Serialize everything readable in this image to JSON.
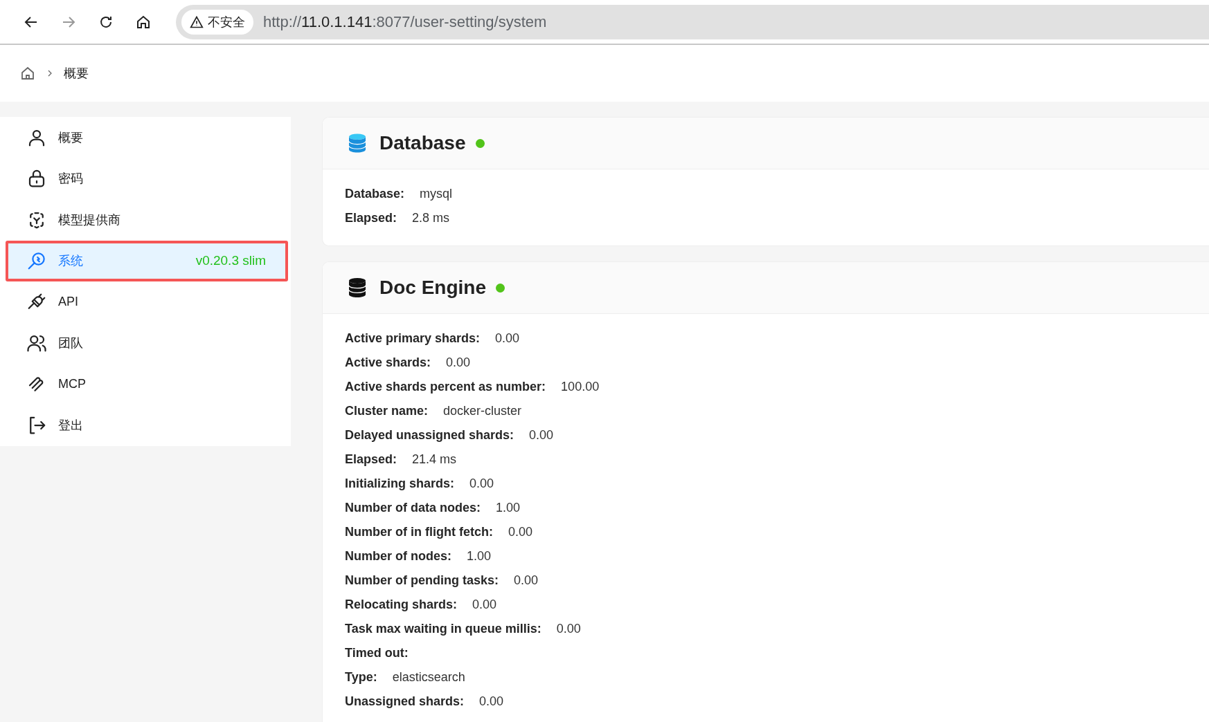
{
  "browser": {
    "security_label": "不安全",
    "url": {
      "scheme": "http://",
      "host": "11.0.1.141",
      "path": ":8077/user-setting/system"
    }
  },
  "breadcrumb": {
    "current": "概要"
  },
  "sidebar": {
    "items": [
      {
        "kind": "user",
        "label": "概要",
        "selected": false
      },
      {
        "kind": "lock",
        "label": "密码",
        "selected": false
      },
      {
        "kind": "model",
        "label": "模型提供商",
        "selected": false
      },
      {
        "kind": "system",
        "label": "系统",
        "selected": true,
        "badge": "v0.20.3 slim",
        "outlined": true
      },
      {
        "kind": "plug",
        "label": "API",
        "selected": false
      },
      {
        "kind": "team",
        "label": "团队",
        "selected": false
      },
      {
        "kind": "mcp",
        "label": "MCP",
        "selected": false
      },
      {
        "kind": "logout",
        "label": "登出",
        "selected": false
      }
    ]
  },
  "cards": [
    {
      "kind": "database",
      "title": "Database",
      "color": "#52c41a",
      "rows": [
        {
          "label": "Database:",
          "value": "mysql"
        },
        {
          "label": "Elapsed:",
          "value": "2.8 ms"
        }
      ]
    },
    {
      "kind": "engine",
      "title": "Doc Engine",
      "color": "#52c41a",
      "rows": [
        {
          "label": "Active primary shards:",
          "value": "0.00"
        },
        {
          "label": "Active shards:",
          "value": "0.00"
        },
        {
          "label": "Active shards percent as number:",
          "value": "100.00"
        },
        {
          "label": "Cluster name:",
          "value": "docker-cluster"
        },
        {
          "label": "Delayed unassigned shards:",
          "value": "0.00"
        },
        {
          "label": "Elapsed:",
          "value": "21.4 ms"
        },
        {
          "label": "Initializing shards:",
          "value": "0.00"
        },
        {
          "label": "Number of data nodes:",
          "value": "1.00"
        },
        {
          "label": "Number of in flight fetch:",
          "value": "0.00"
        },
        {
          "label": "Number of nodes:",
          "value": "1.00"
        },
        {
          "label": "Number of pending tasks:",
          "value": "0.00"
        },
        {
          "label": "Relocating shards:",
          "value": "0.00"
        },
        {
          "label": "Task max waiting in queue millis:",
          "value": "0.00"
        },
        {
          "label": "Timed out:"
        },
        {
          "label": "Type:",
          "value": "elasticsearch"
        },
        {
          "label": "Unassigned shards:",
          "value": "0.00"
        }
      ]
    }
  ]
}
